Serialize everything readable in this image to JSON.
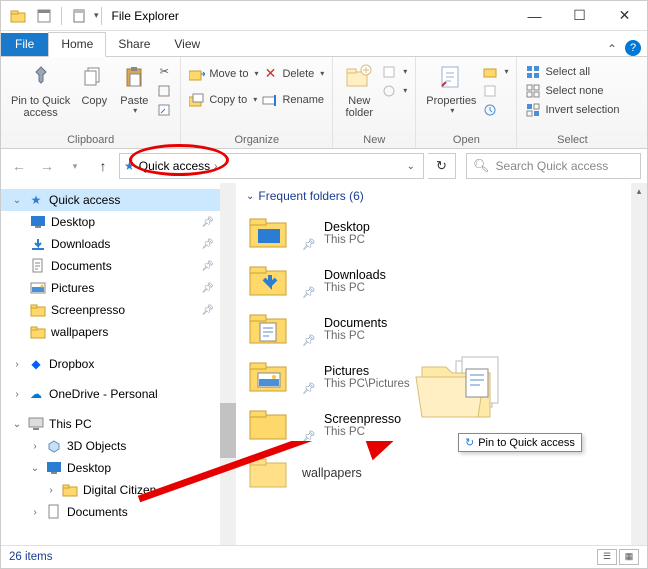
{
  "window": {
    "title": "File Explorer"
  },
  "tabs": {
    "file": "File",
    "home": "Home",
    "share": "Share",
    "view": "View"
  },
  "ribbon": {
    "clipboard": {
      "label": "Clipboard",
      "pin": "Pin to Quick\naccess",
      "copy": "Copy",
      "paste": "Paste"
    },
    "organize": {
      "label": "Organize",
      "moveto": "Move to",
      "copyto": "Copy to",
      "delete": "Delete",
      "rename": "Rename"
    },
    "new": {
      "label": "New",
      "newfolder": "New\nfolder"
    },
    "open": {
      "label": "Open",
      "properties": "Properties"
    },
    "select": {
      "label": "Select",
      "all": "Select all",
      "none": "Select none",
      "invert": "Invert selection"
    }
  },
  "nav": {
    "address": "Quick access",
    "search_placeholder": "Search Quick access"
  },
  "tree": {
    "qa": "Quick access",
    "desktop": "Desktop",
    "downloads": "Downloads",
    "documents": "Documents",
    "pictures": "Pictures",
    "screenpresso": "Screenpresso",
    "wallpapers": "wallpapers",
    "dropbox": "Dropbox",
    "onedrive": "OneDrive - Personal",
    "thispc": "This PC",
    "obj3d": "3D Objects",
    "tpdesktop": "Desktop",
    "digitalcitizen": "Digital Citizen",
    "tpdocuments": "Documents"
  },
  "content": {
    "group_header": "Frequent folders (6)",
    "items": [
      {
        "name": "Desktop",
        "loc": "This PC"
      },
      {
        "name": "Downloads",
        "loc": "This PC"
      },
      {
        "name": "Documents",
        "loc": "This PC"
      },
      {
        "name": "Pictures",
        "loc": "This PC\\Pictures"
      },
      {
        "name": "Screenpresso",
        "loc": "This PC"
      },
      {
        "name": "wallpapers",
        "loc": ""
      }
    ]
  },
  "drag": {
    "tooltip": "Pin to Quick access"
  },
  "status": {
    "items": "26 items"
  }
}
